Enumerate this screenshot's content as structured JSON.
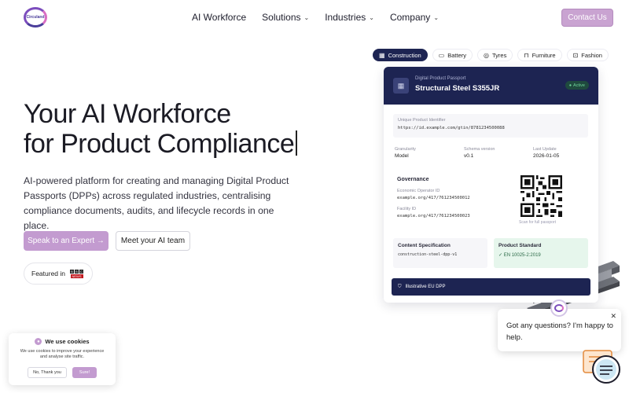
{
  "brand": {
    "logo_text": "Circuland",
    "accent": "#c39bd0",
    "navy": "#1d2452"
  },
  "nav": {
    "items": [
      {
        "label": "AI Workforce",
        "has_dropdown": false
      },
      {
        "label": "Solutions",
        "has_dropdown": true
      },
      {
        "label": "Industries",
        "has_dropdown": true
      },
      {
        "label": "Company",
        "has_dropdown": true
      }
    ],
    "contact_label": "Contact Us"
  },
  "hero": {
    "title_line1": "Your AI Workforce",
    "title_line2": "for Product Compliance",
    "description": "AI-powered platform for creating and managing Digital Product Passports (DPPs) across regulated industries, centralising compliance documents, audits, and lifecycle records in one place.",
    "cta_primary": "Speak to an Expert →",
    "cta_secondary": "Meet your AI team",
    "featured_label": "Featured in",
    "featured_logo": "BBC NEWS"
  },
  "industry_tabs": [
    {
      "label": "Construction",
      "icon": "building-icon",
      "active": true
    },
    {
      "label": "Battery",
      "icon": "battery-icon",
      "active": false
    },
    {
      "label": "Tyres",
      "icon": "tyre-icon",
      "active": false
    },
    {
      "label": "Furniture",
      "icon": "sofa-icon",
      "active": false
    },
    {
      "label": "Fashion",
      "icon": "bag-icon",
      "active": false
    }
  ],
  "passport": {
    "header_sub": "Digital Product Passport",
    "header_title": "Structural Steel S355JR",
    "status": "Active",
    "uid_label": "Unique Product Identifier",
    "uid_value": "https://id.example.com/gtin/8781234500088",
    "meta": [
      {
        "label": "Granularity",
        "value": "Model"
      },
      {
        "label": "Schema version",
        "value": "v0.1"
      },
      {
        "label": "Last Update",
        "value": "2026-01-05"
      }
    ],
    "governance_title": "Governance",
    "operator_label": "Economic Operator ID",
    "operator_value": "example.org/417/761234500012",
    "facility_label": "Facility ID",
    "facility_value": "example.org/417/761234500023",
    "qr_note": "Scan for full passport",
    "content_spec_title": "Content Specification",
    "content_spec_value": "construction-steel-dpp-v1",
    "product_standard_title": "Product Standard",
    "product_standard_value": "EN 10025-2:2019",
    "footer": "Illustrative EU DPP"
  },
  "chat": {
    "message": "Got any questions? I'm happy to help.",
    "close_icon": "close-icon"
  },
  "cookie": {
    "title": "We use cookies",
    "text": "We use cookies to improve your experience and analyse site traffic.",
    "decline_label": "No, Thank you",
    "accept_label": "Sure!"
  }
}
